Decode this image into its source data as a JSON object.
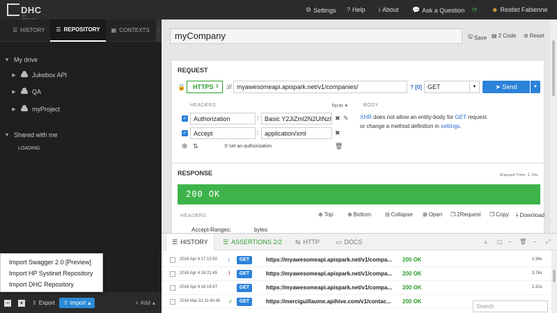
{
  "topbar": {
    "logo": "DHC",
    "logo_sub": "BY RESTLET",
    "settings": "Settings",
    "help": "Help",
    "about": "About",
    "ask": "Ask a Question",
    "user": "Restlet Fabienne"
  },
  "left": {
    "tabs": [
      "HISTORY",
      "REPOSITORY",
      "CONTEXTS"
    ],
    "my_drive": "My drive",
    "projects": [
      "Jukebox API",
      "QA",
      "myProject"
    ],
    "shared": "Shared with me",
    "loading": "LOADING",
    "import_menu": [
      "Import Swagger 2.0 [Preview]",
      "Import HP Systinet Repository",
      "Import DHC Repository"
    ],
    "footer": {
      "export": "Export",
      "import": "Import",
      "add": "Add"
    }
  },
  "request": {
    "name": "myCompany",
    "actions": {
      "save": "Save",
      "code": "2 Code",
      "reset": "Reset"
    },
    "section_title": "REQUEST",
    "scheme": "HTTPS",
    "scheme_sep": "://",
    "url": "myawesomeapi.apispark.net/v1/companies/",
    "params_hint": "? [0]",
    "method": "GET",
    "send": "Send",
    "headers_label": "HEADERS",
    "form_label": "form",
    "headers": [
      {
        "name": "Authorization",
        "value": "Basic Y2JiZml2N2UtNzI"
      },
      {
        "name": "Accept",
        "value": "application/xml"
      }
    ],
    "set_authorization": "set an authorization",
    "body_label": "BODY",
    "body_xhr": "XHR",
    "body_line1": " does not allow an entity-body for ",
    "body_get": "GET",
    "body_line1_end": " request.",
    "body_line2": "or change a method definition in ",
    "body_settings": "settings",
    "body_line2_end": "."
  },
  "response": {
    "section_title": "RESPONSE",
    "elapsed": "Elapsed Time: 1.34s",
    "status": "200 OK",
    "headers_label": "HEADERS",
    "tools": [
      "Top",
      "Bottom",
      "Collapse",
      "Open",
      "2Request",
      "Copy",
      "Download"
    ],
    "partial_header_name": "Accept-Ranges:",
    "partial_header_value": "bytes"
  },
  "bottom": {
    "tabs": [
      "HISTORY",
      "ASSERTIONS 2/2",
      "HTTP",
      "DOCS"
    ],
    "rows": [
      {
        "date": "2016 Apr 4 17:15:50",
        "flag": "i",
        "method": "GET",
        "url": "https://myawesomeapi.apispark.net/v1/compa...",
        "status": "200 OK",
        "time": "1.34s"
      },
      {
        "date": "2016 Apr 4 16:21:45",
        "flag": "!",
        "method": "GET",
        "url": "https://myawesomeapi.apispark.net/v1/compa...",
        "status": "200 OK",
        "time": "3.74s"
      },
      {
        "date": "2016 Apr 4 16:19:47",
        "flag": "",
        "method": "GET",
        "url": "https://myawesomeapi.apispark.net/v1/compa...",
        "status": "200 OK",
        "time": "1.31s"
      },
      {
        "date": "2016 Mar 31 11:40:45",
        "flag": "✓",
        "method": "GET",
        "url": "https://merciguillaume.apihive.com/v1/contac...",
        "status": "200 OK",
        "time": ""
      }
    ],
    "search_placeholder": "Search"
  }
}
